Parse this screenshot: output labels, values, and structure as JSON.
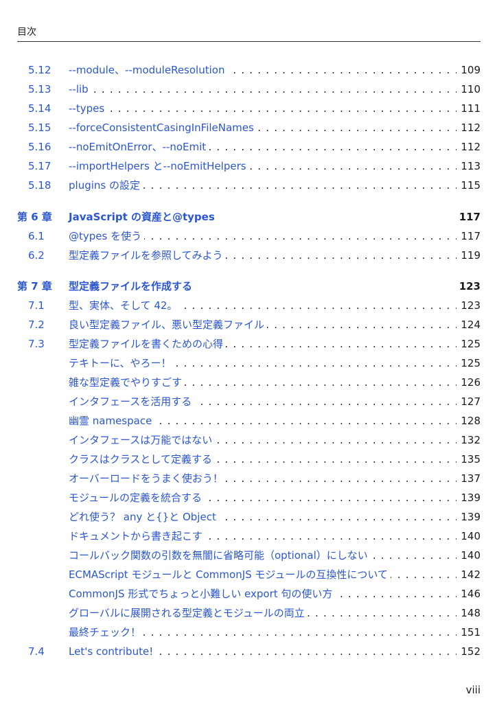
{
  "header": {
    "title": "目次"
  },
  "entries": [
    {
      "num": "5.12",
      "title": "--module、--moduleResolution",
      "page": "109",
      "level": "section"
    },
    {
      "num": "5.13",
      "title": "--lib",
      "page": "110",
      "level": "section"
    },
    {
      "num": "5.14",
      "title": "--types",
      "page": "111",
      "level": "section"
    },
    {
      "num": "5.15",
      "title": "--forceConsistentCasingInFileNames",
      "page": "112",
      "level": "section"
    },
    {
      "num": "5.16",
      "title": "--noEmitOnError、--noEmit",
      "page": "112",
      "level": "section"
    },
    {
      "num": "5.17",
      "title": "--importHelpers と--noEmitHelpers",
      "page": "113",
      "level": "section"
    },
    {
      "num": "5.18",
      "title": "plugins の設定",
      "page": "115",
      "level": "section"
    },
    {
      "num": "第 6 章",
      "title": "JavaScript の資産と@types",
      "page": "117",
      "level": "chapter"
    },
    {
      "num": "6.1",
      "title": "@types を使う",
      "page": "117",
      "level": "section"
    },
    {
      "num": "6.2",
      "title": "型定義ファイルを参照してみよう",
      "page": "119",
      "level": "section"
    },
    {
      "num": "第 7 章",
      "title": "型定義ファイルを作成する",
      "page": "123",
      "level": "chapter"
    },
    {
      "num": "7.1",
      "title": "型、実体、そして 42。",
      "page": "123",
      "level": "section"
    },
    {
      "num": "7.2",
      "title": "良い型定義ファイル、悪い型定義ファイル",
      "page": "124",
      "level": "section"
    },
    {
      "num": "7.3",
      "title": "型定義ファイルを書くための心得",
      "page": "125",
      "level": "section"
    },
    {
      "num": "",
      "title": "テキトーに、やろー！",
      "page": "125",
      "level": "sub"
    },
    {
      "num": "",
      "title": "雑な型定義でやりすごす",
      "page": "126",
      "level": "sub"
    },
    {
      "num": "",
      "title": "インタフェースを活用する",
      "page": "127",
      "level": "sub"
    },
    {
      "num": "",
      "title": "幽霊 namespace",
      "page": "128",
      "level": "sub"
    },
    {
      "num": "",
      "title": "インタフェースは万能ではない",
      "page": "132",
      "level": "sub"
    },
    {
      "num": "",
      "title": "クラスはクラスとして定義する",
      "page": "135",
      "level": "sub"
    },
    {
      "num": "",
      "title": "オーバーロードをうまく使おう！",
      "page": "137",
      "level": "sub"
    },
    {
      "num": "",
      "title": "モジュールの定義を統合する",
      "page": "139",
      "level": "sub"
    },
    {
      "num": "",
      "title": "どれ使う？ any と{}と Object",
      "page": "139",
      "level": "sub"
    },
    {
      "num": "",
      "title": "ドキュメントから書き起こす",
      "page": "140",
      "level": "sub"
    },
    {
      "num": "",
      "title": "コールバック関数の引数を無闇に省略可能（optional）にしない",
      "page": "140",
      "level": "sub"
    },
    {
      "num": "",
      "title": "ECMAScript モジュールと CommonJS モジュールの互換性について",
      "page": "142",
      "level": "sub"
    },
    {
      "num": "",
      "title": "CommonJS 形式でちょっと小難しい export 句の使い方",
      "page": "146",
      "level": "sub"
    },
    {
      "num": "",
      "title": "グローバルに展開される型定義とモジュールの両立",
      "page": "148",
      "level": "sub"
    },
    {
      "num": "",
      "title": "最終チェック！",
      "page": "151",
      "level": "sub"
    },
    {
      "num": "7.4",
      "title": "Let's contribute!",
      "page": "152",
      "level": "section"
    }
  ],
  "footer": {
    "page_number": "viii"
  }
}
